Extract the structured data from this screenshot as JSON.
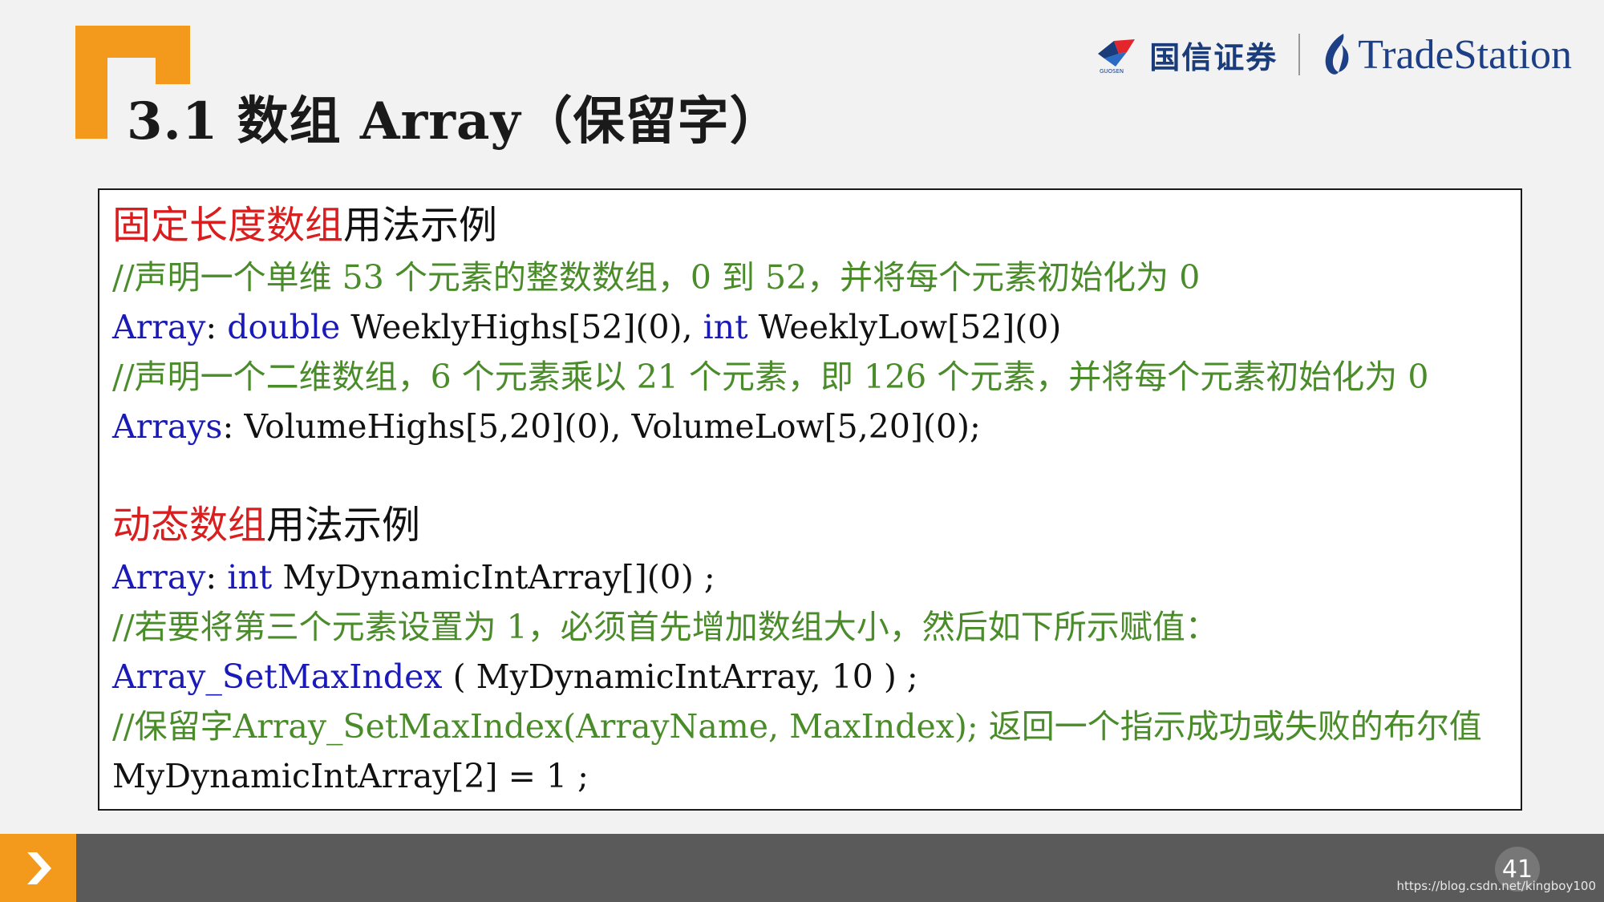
{
  "slide": {
    "title": "3.1 数组 Array（保留字）",
    "page_number": "41",
    "watermark": "https://blog.csdn.net/kingboy100"
  },
  "logos": {
    "guosen_text": "国信证券",
    "guosen_small": "GUOSEN",
    "tradestation_text": "TradeStation"
  },
  "fixed_section": {
    "heading_red": "固定长度数组",
    "heading_black": "用法示例",
    "comment1": "//声明一个单维 53 个元素的整数数组，0 到 52，并将每个元素初始化为 0",
    "code1_kw1": "Array",
    "code1_colon": ": ",
    "code1_kw2": "double",
    "code1_rest1": " WeeklyHighs[52](0), ",
    "code1_kw3": "int",
    "code1_rest2": " WeeklyLow[52](0)",
    "comment2": "//声明一个二维数组，6 个元素乘以 21 个元素，即 126 个元素，并将每个元素初始化为 0",
    "code2_kw1": "Arrays",
    "code2_rest": ": VolumeHighs[5,20](0), VolumeLow[5,20](0);"
  },
  "dynamic_section": {
    "heading_red": "动态数组",
    "heading_black": "用法示例",
    "code1_kw1": "Array",
    "code1_colon": ": ",
    "code1_kw2": "int",
    "code1_rest": " MyDynamicIntArray[](0) ;",
    "comment1": "//若要将第三个元素设置为 1，必须首先增加数组大小，然后如下所示赋值：",
    "code2_kw1": "Array_SetMaxIndex",
    "code2_rest": " ( MyDynamicIntArray, 10 ) ;",
    "comment2": "//保留字Array_SetMaxIndex(ArrayName, MaxIndex); 返回一个指示成功或失败的布尔值",
    "code3": "MyDynamicIntArray[2] = 1 ;"
  },
  "colors": {
    "accent_orange": "#f39a1d",
    "heading_red": "#d81e1e",
    "keyword_blue": "#1a1ab8",
    "comment_green": "#4a8c2a",
    "bottom_bar_gray": "#5a5a5a"
  }
}
